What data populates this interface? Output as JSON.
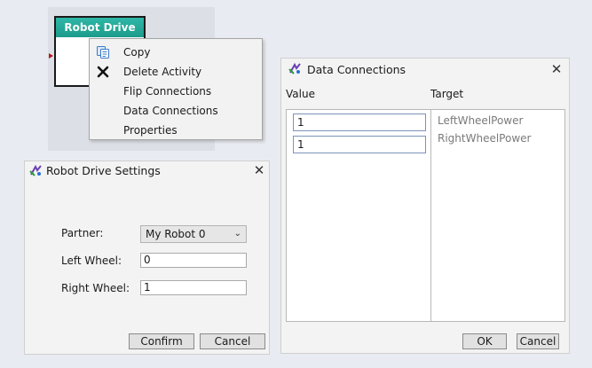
{
  "activity": {
    "title": "Robot Drive"
  },
  "context_menu": {
    "items": [
      {
        "label": "Copy",
        "icon": "copy-icon"
      },
      {
        "label": "Delete Activity",
        "icon": "delete-x-icon"
      },
      {
        "label": "Flip Connections",
        "icon": ""
      },
      {
        "label": "Data Connections",
        "icon": ""
      },
      {
        "label": "Properties",
        "icon": ""
      }
    ]
  },
  "settings_dialog": {
    "title": "Robot Drive Settings",
    "partner_label": "Partner:",
    "partner_value": "My Robot 0",
    "left_wheel_label": "Left Wheel:",
    "left_wheel_value": "0",
    "right_wheel_label": "Right Wheel:",
    "right_wheel_value": "1",
    "confirm_label": "Confirm",
    "cancel_label": "Cancel"
  },
  "data_connections_dialog": {
    "title": "Data Connections",
    "value_header": "Value",
    "target_header": "Target",
    "values": [
      "1",
      "1"
    ],
    "targets": [
      "LeftWheelPower",
      "RightWheelPower"
    ],
    "ok_label": "OK",
    "cancel_label": "Cancel"
  },
  "colors": {
    "activity_header": "#1d9b8b",
    "background": "#e8ebf1",
    "dialog": "#f3f3f3"
  }
}
